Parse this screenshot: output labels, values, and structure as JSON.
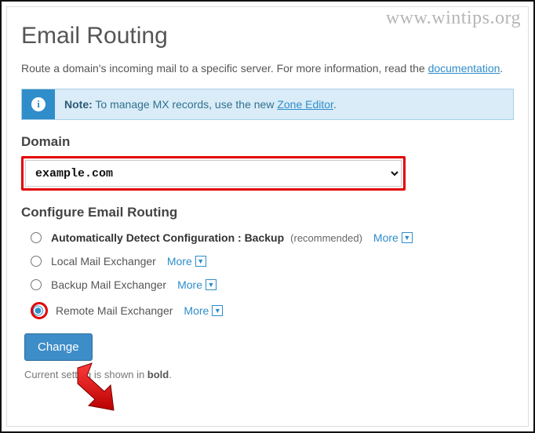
{
  "watermark": "www.wintips.org",
  "page": {
    "title": "Email Routing"
  },
  "desc": {
    "prefix": "Route a domain's incoming mail to a specific server. For more information, read the ",
    "link": "documentation",
    "suffix": "."
  },
  "info": {
    "icon_glyph": "i",
    "note_label": "Note:",
    "text_before": " To manage MX records, use the new ",
    "link": "Zone Editor",
    "text_after": "."
  },
  "domain": {
    "label": "Domain",
    "selected": "example.com"
  },
  "configure": {
    "label": "Configure Email Routing",
    "more_label": "More",
    "options": [
      {
        "label": "Automatically Detect Configuration : Backup",
        "rec": "(recommended)",
        "bold": true,
        "checked": false
      },
      {
        "label": "Local Mail Exchanger",
        "rec": "",
        "bold": false,
        "checked": false
      },
      {
        "label": "Backup Mail Exchanger",
        "rec": "",
        "bold": false,
        "checked": false
      },
      {
        "label": "Remote Mail Exchanger",
        "rec": "",
        "bold": false,
        "checked": true
      }
    ]
  },
  "change_button": "Change",
  "current_note": {
    "prefix": "Current setting is shown in ",
    "bold": "bold",
    "suffix": "."
  }
}
